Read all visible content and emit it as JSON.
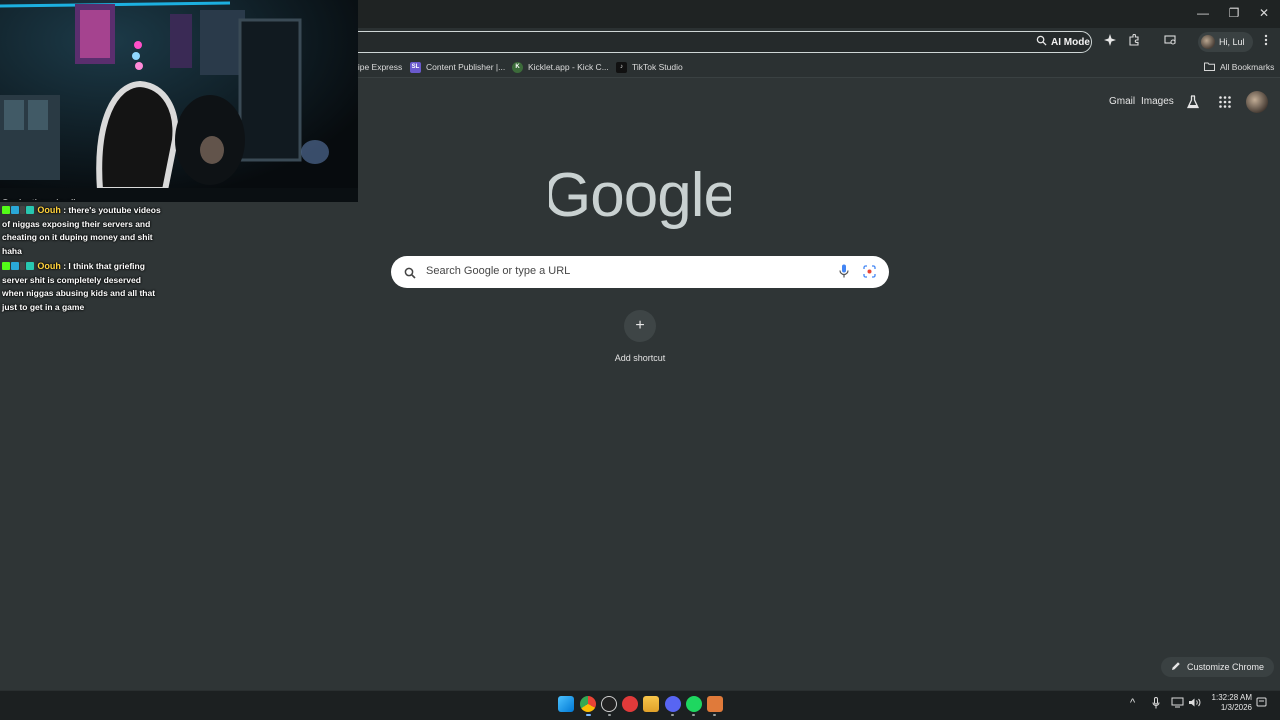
{
  "window": {
    "minimize_label": "—",
    "restore_label": "❐",
    "close_label": "✕"
  },
  "toolbar": {
    "ai_mode_label": "AI Mode",
    "profile_greeting": "Hi, Lul"
  },
  "bookmarks": {
    "items": [
      {
        "label": "ripe Express",
        "icon": "page-icon"
      },
      {
        "label": "Content Publisher |...",
        "icon": "sl-icon"
      },
      {
        "label": "Kicklet.app - Kick C...",
        "icon": "kicklet-icon"
      },
      {
        "label": "TikTok Studio",
        "icon": "tiktok-icon"
      }
    ],
    "all_bookmarks_label": "All Bookmarks"
  },
  "chat": {
    "partial_top": "Oouh : they ain all",
    "messages": [
      {
        "user": "Oouh",
        "text": " : there's youtube videos of niggas exposing their servers and cheating on it duping money and shit haha"
      },
      {
        "user": "Oouh",
        "text": " : I think that griefing server shit is completely deserved when niggas abusing kids and all that just to get in a game"
      }
    ]
  },
  "ntp": {
    "gmail_label": "Gmail",
    "images_label": "Images",
    "logo_text": "Google",
    "search_placeholder": "Search Google or type a URL",
    "add_shortcut_label": "Add shortcut",
    "customize_label": "Customize Chrome"
  },
  "taskbar": {
    "time": "1:32:28 AM",
    "date": "1/3/2026",
    "apps": [
      "windows-start-icon",
      "chrome-icon",
      "obs-icon",
      "record-icon",
      "file-explorer-icon",
      "discord-icon",
      "spotify-icon",
      "app-icon"
    ]
  }
}
